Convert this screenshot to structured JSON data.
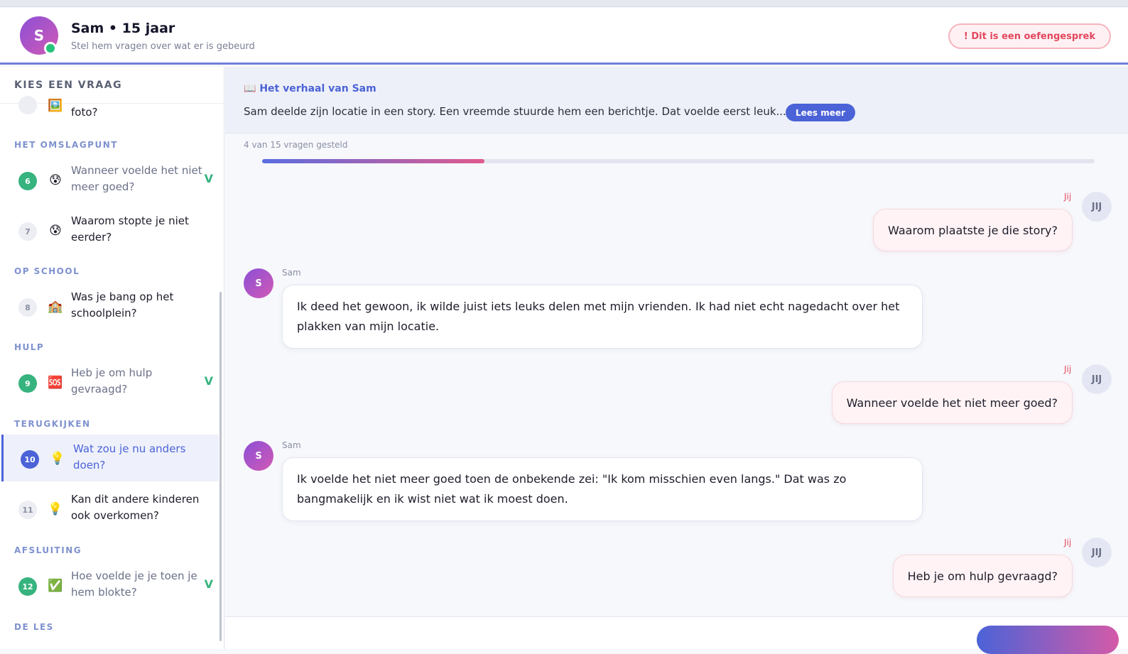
{
  "header": {
    "avatar_letter": "S",
    "name": "Sam • 15 jaar",
    "subtitle": "Stel hem vragen over wat er is gebeurd",
    "practice_badge": "! Dit is een oefengesprek"
  },
  "sidebar": {
    "title": "KIES EEN VRAAG",
    "partial_item": {
      "text": "foto?",
      "emoji": "🖼️"
    },
    "sections": [
      {
        "label": "HET OMSLAGPUNT"
      },
      {
        "label": "OP SCHOOL"
      },
      {
        "label": "HULP"
      },
      {
        "label": "TERUGKIJKEN"
      },
      {
        "label": "AFSLUITING"
      },
      {
        "label": "DE LES"
      }
    ],
    "questions": [
      {
        "number": "6",
        "emoji": "😰",
        "text": "Wanneer voelde het niet meer goed?",
        "status": "done",
        "check": "V"
      },
      {
        "number": "7",
        "emoji": "😰",
        "text": "Waarom stopte je niet eerder?",
        "status": "todo",
        "check": ""
      },
      {
        "number": "8",
        "emoji": "🏫",
        "text": "Was je bang op het schoolplein?",
        "status": "todo",
        "check": ""
      },
      {
        "number": "9",
        "emoji": "🆘",
        "text": "Heb je om hulp gevraagd?",
        "status": "done",
        "check": "V"
      },
      {
        "number": "10",
        "emoji": "💡",
        "text": "Wat zou je nu anders doen?",
        "status": "current",
        "check": ""
      },
      {
        "number": "11",
        "emoji": "💡",
        "text": "Kan dit andere kinderen ook overkomen?",
        "status": "todo",
        "check": ""
      },
      {
        "number": "12",
        "emoji": "✅",
        "text": "Hoe voelde je je toen je hem blokte?",
        "status": "done",
        "check": "V"
      }
    ]
  },
  "story": {
    "icon": "📖",
    "title": "Het verhaal van Sam",
    "text": "Sam deelde zijn locatie in een story. Een vreemde stuurde hem een berichtje. Dat voelde eerst leuk...",
    "read_more": "Lees meer"
  },
  "progress": {
    "label": "4 van 15 vragen gesteld",
    "asked": 4,
    "total": 15
  },
  "chat": {
    "me_label": "Jij",
    "me_avatar": "JIJ",
    "sam_label": "Sam",
    "sam_avatar": "S",
    "messages": [
      {
        "from": "me",
        "text": "Waarom plaatste je die story?"
      },
      {
        "from": "sam",
        "text": "Ik deed het gewoon, ik wilde juist iets leuks delen met mijn vrienden. Ik had niet echt nagedacht over het plakken van mijn locatie."
      },
      {
        "from": "me",
        "text": "Wanneer voelde het niet meer goed?"
      },
      {
        "from": "sam",
        "text": "Ik voelde het niet meer goed toen de onbekende zei: \"Ik kom misschien even langs.\" Dat was zo bangmakelijk en ik wist niet wat ik moest doen."
      },
      {
        "from": "me",
        "text": "Heb je om hulp gevraagd?"
      }
    ]
  },
  "colors": {
    "accent": "#4b63d7",
    "done": "#36b37e",
    "alert": "#e2485e"
  }
}
